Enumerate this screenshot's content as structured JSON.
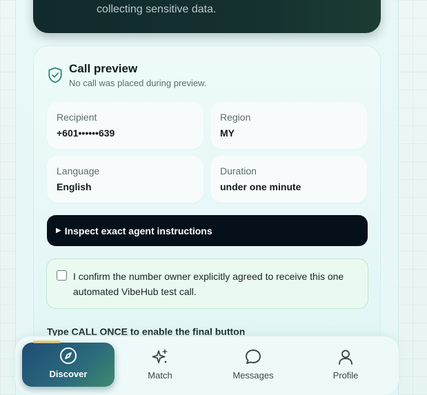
{
  "top_card": {
    "text": "collecting sensitive data."
  },
  "call_preview": {
    "title": "Call preview",
    "subtitle": "No call was placed during preview.",
    "fields": [
      {
        "label": "Recipient",
        "value": "+601••••••639"
      },
      {
        "label": "Region",
        "value": "MY"
      },
      {
        "label": "Language",
        "value": "English"
      },
      {
        "label": "Duration",
        "value": "under one minute"
      }
    ],
    "inspect_label": "Inspect exact agent instructions",
    "confirm_text": "I confirm the number owner explicitly agreed to receive this one automated VibeHub test call.",
    "confirm_checked": false,
    "type_prompt": "Type CALL ONCE to enable the final button"
  },
  "nav": {
    "items": [
      {
        "label": "Discover",
        "icon": "compass-icon",
        "active": true
      },
      {
        "label": "Match",
        "icon": "sparkles-icon",
        "active": false
      },
      {
        "label": "Messages",
        "icon": "chat-bubble-icon",
        "active": false
      },
      {
        "label": "Profile",
        "icon": "person-icon",
        "active": false
      }
    ]
  },
  "colors": {
    "accent_dark": "#06101a",
    "nav_active_start": "#1f4d74",
    "nav_active_end": "#3e8a6d",
    "confirm_bg": "#eafaf0",
    "shield": "#2e8b6b"
  }
}
